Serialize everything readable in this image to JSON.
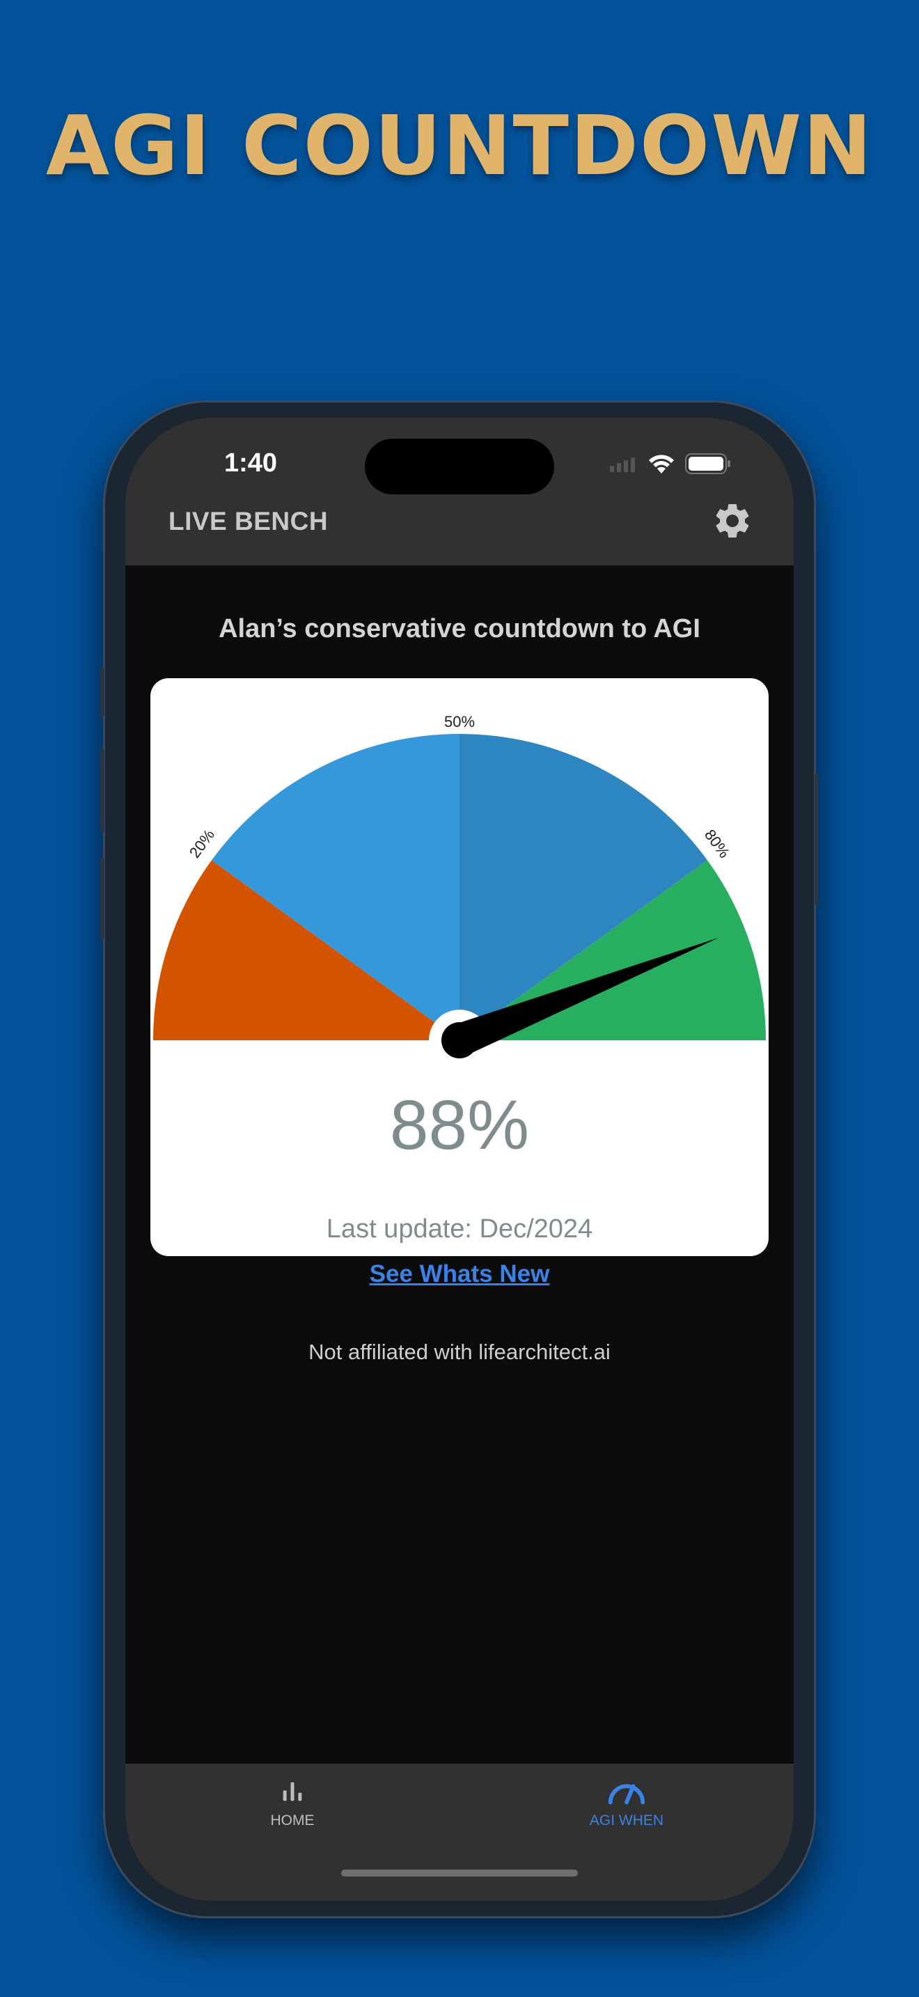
{
  "promo": {
    "title": "AGI COUNTDOWN"
  },
  "status_bar": {
    "time": "1:40"
  },
  "header": {
    "title": "LIVE BENCH"
  },
  "main": {
    "headline": "Alan’s conservative countdown to AGI",
    "gauge": {
      "value_percent": 88,
      "value_text": "88%",
      "tick_labels": [
        "20%",
        "50%",
        "80%"
      ],
      "colors": {
        "low": "#d35400",
        "mid_left": "#3498db",
        "mid_right": "#2e86c1",
        "high": "#27ae60"
      },
      "last_update": "Last update: Dec/2024"
    },
    "whats_new_link": "See Whats New",
    "disclaimer": "Not affiliated with lifearchitect.ai"
  },
  "tabs": [
    {
      "label": "HOME",
      "icon": "bar-chart-icon",
      "active": false
    },
    {
      "label": "AGI WHEN",
      "icon": "speedometer-icon",
      "active": true
    }
  ],
  "theme": {
    "accent": "#3b82e6",
    "background": "#03529a",
    "title_gold": "#e0b46a"
  }
}
